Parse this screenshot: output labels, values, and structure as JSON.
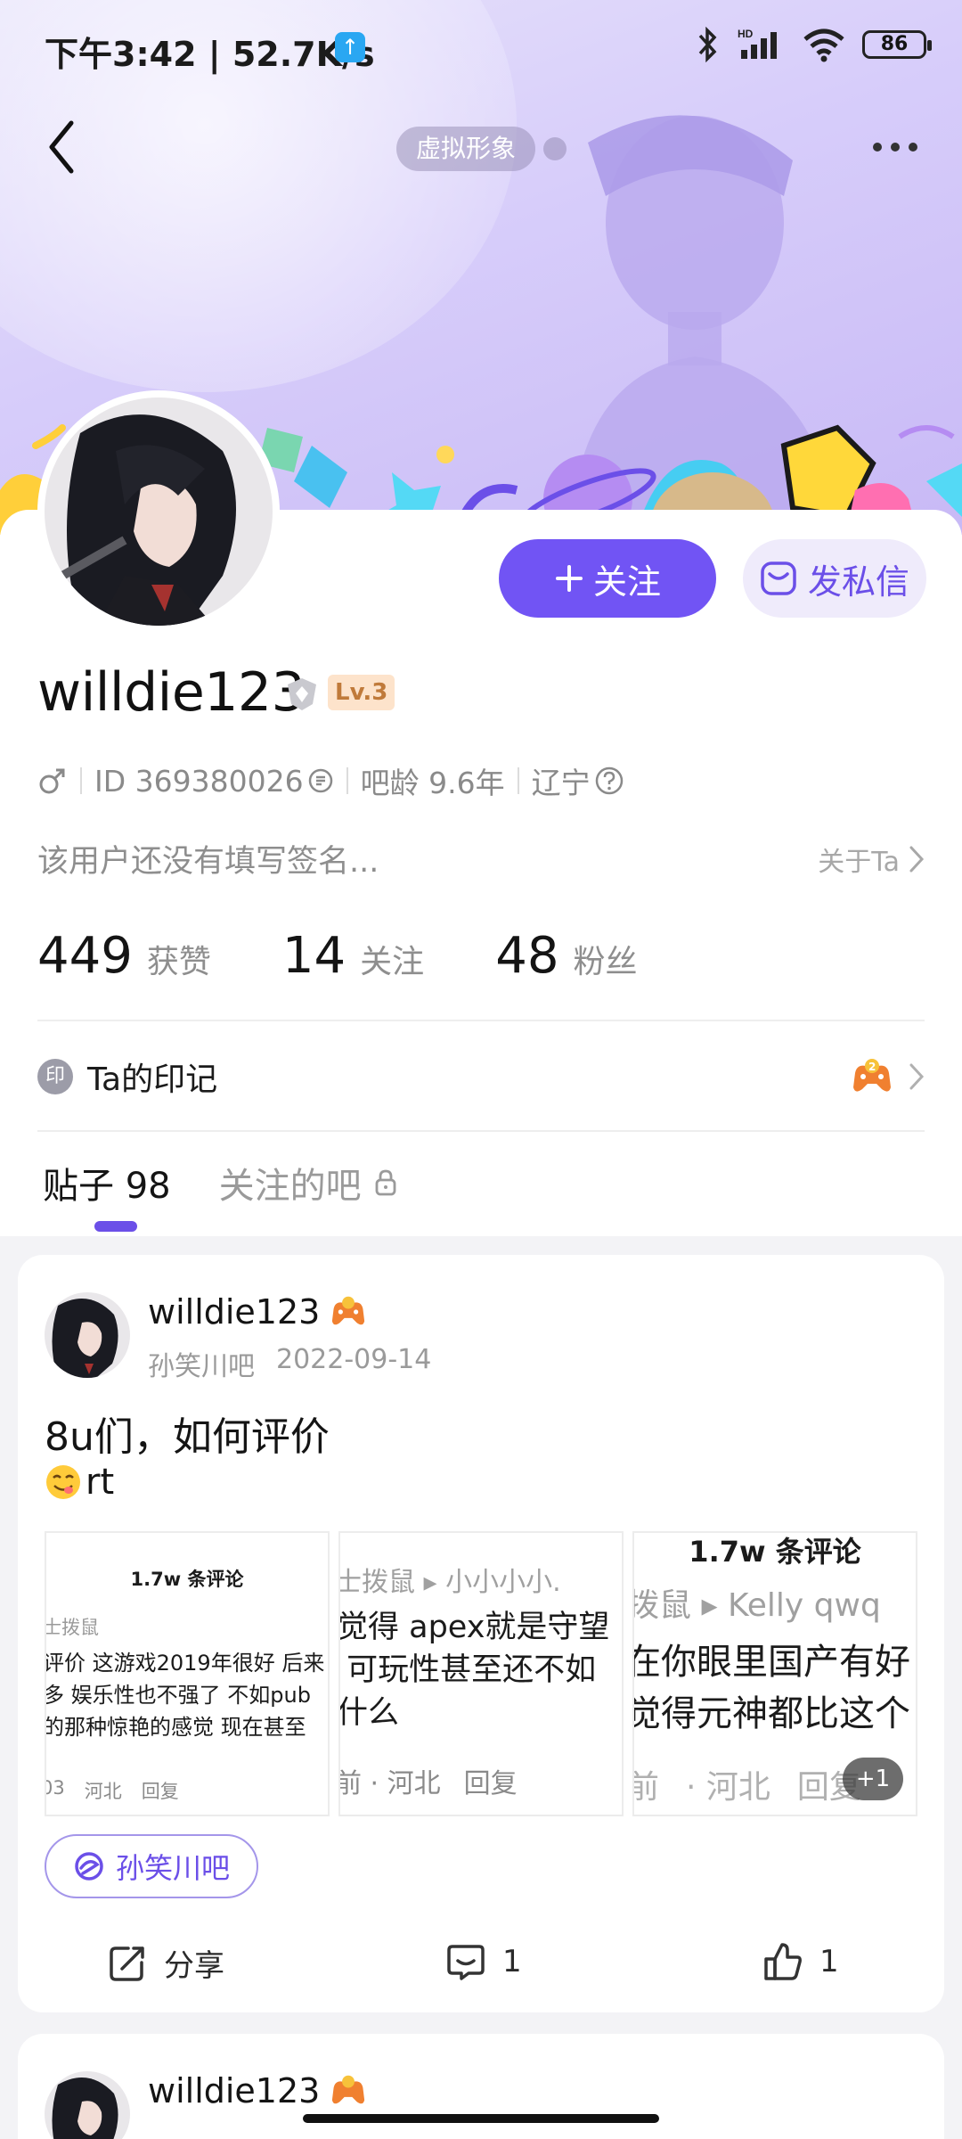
{
  "status_bar": {
    "time_speed": "下午3:42 | 52.7K/s",
    "battery": "86"
  },
  "header": {
    "avatar_tag": "虚拟形象"
  },
  "profile": {
    "follow_label": "关注",
    "message_label": "发私信",
    "username": "willdie123",
    "level": "Lv.3",
    "id_text": "ID 369380026",
    "bar_age": "吧龄 9.6年",
    "location": "辽宁",
    "signature": "该用户还没有填写签名...",
    "about_label": "关于Ta",
    "stats": [
      {
        "value": "449",
        "label": "获赞"
      },
      {
        "value": "14",
        "label": "关注"
      },
      {
        "value": "48",
        "label": "粉丝"
      }
    ],
    "mark_icon_text": "印",
    "mark_label": "Ta的印记"
  },
  "tabs": {
    "posts_label": "贴子 98",
    "followed_bars_label": "关注的吧"
  },
  "post": {
    "author": "willdie123",
    "forum": "孙笑川吧",
    "date": "2022-09-14",
    "title": "8u们，如何评价",
    "body_text": "rt",
    "thumb1": {
      "header": "1.7w 条评论",
      "user": "士拨鼠",
      "line1": "评价 这游戏2019年很好 后来",
      "line2": "多 娱乐性也不强了 不如pub",
      "line3": "的那种惊艳的感觉 现在甚至",
      "foot_time": "03",
      "foot_loc": "河北",
      "foot_reply": "回复"
    },
    "thumb2": {
      "user": "士拨鼠 ▸ 小小小小.",
      "line1": "觉得 apex就是守望",
      "line2": " 可玩性甚至还不如",
      "line3": "什么",
      "foot_time": "前 · 河北",
      "foot_reply": "回复"
    },
    "thumb3": {
      "header": "1.7w 条评论",
      "user": "拨鼠 ▸ Kelly qwq",
      "line1": "在你眼里国产有好",
      "line2": "觉得元神都比这个",
      "foot_time": "前",
      "foot_loc": "·  河北",
      "foot_reply": "回复",
      "plus": "+1"
    },
    "forum_chip": "孙笑川吧",
    "share_label": "分享",
    "comment_count": "1",
    "like_count": "1"
  },
  "post2": {
    "author": "willdie123"
  }
}
